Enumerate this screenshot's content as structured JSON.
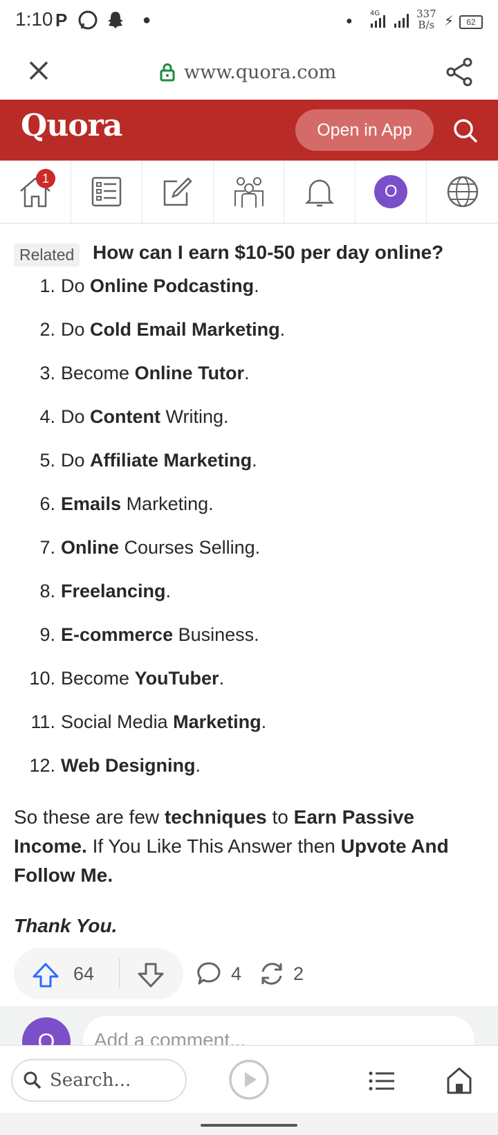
{
  "status_bar": {
    "time": "1:10",
    "net_type": "4G",
    "speed_value": "337",
    "speed_unit": "B/s",
    "battery": "62"
  },
  "browser": {
    "url": "www.quora.com"
  },
  "header": {
    "logo": "Quora",
    "open_in_app": "Open in App"
  },
  "nav": {
    "home_badge": "1",
    "avatar_letter": "O"
  },
  "answer": {
    "related_label": "Related",
    "question": "How can I earn $10-50 per day online?",
    "list": [
      {
        "num": "1.",
        "parts": [
          {
            "t": "Do ",
            "b": false
          },
          {
            "t": "Online Podcasting",
            "b": true
          },
          {
            "t": ".",
            "b": false
          }
        ]
      },
      {
        "num": "2.",
        "parts": [
          {
            "t": "Do ",
            "b": false
          },
          {
            "t": "Cold Email Marketing",
            "b": true
          },
          {
            "t": ".",
            "b": false
          }
        ]
      },
      {
        "num": "3.",
        "parts": [
          {
            "t": "Become ",
            "b": false
          },
          {
            "t": "Online Tutor",
            "b": true
          },
          {
            "t": ".",
            "b": false
          }
        ]
      },
      {
        "num": "4.",
        "parts": [
          {
            "t": "Do ",
            "b": false
          },
          {
            "t": "Content",
            "b": true
          },
          {
            "t": " Writing.",
            "b": false
          }
        ]
      },
      {
        "num": "5.",
        "parts": [
          {
            "t": "Do ",
            "b": false
          },
          {
            "t": "Affiliate Marketing",
            "b": true
          },
          {
            "t": ".",
            "b": false
          }
        ]
      },
      {
        "num": "6.",
        "parts": [
          {
            "t": "Emails",
            "b": true
          },
          {
            "t": " Marketing.",
            "b": false
          }
        ]
      },
      {
        "num": "7.",
        "parts": [
          {
            "t": "Online",
            "b": true
          },
          {
            "t": " Courses Selling.",
            "b": false
          }
        ]
      },
      {
        "num": "8.",
        "parts": [
          {
            "t": "Freelancing",
            "b": true
          },
          {
            "t": ".",
            "b": false
          }
        ]
      },
      {
        "num": "9.",
        "parts": [
          {
            "t": "E-commerce",
            "b": true
          },
          {
            "t": " Business.",
            "b": false
          }
        ]
      },
      {
        "num": "10.",
        "parts": [
          {
            "t": "Become ",
            "b": false
          },
          {
            "t": "YouTuber",
            "b": true
          },
          {
            "t": ".",
            "b": false
          }
        ]
      },
      {
        "num": "11.",
        "parts": [
          {
            "t": "Social Media ",
            "b": false
          },
          {
            "t": "Marketing",
            "b": true
          },
          {
            "t": ".",
            "b": false
          }
        ]
      },
      {
        "num": "12.",
        "parts": [
          {
            "t": "Web Designing",
            "b": true
          },
          {
            "t": ".",
            "b": false
          }
        ]
      }
    ],
    "closing": [
      {
        "t": "So these are few ",
        "b": false
      },
      {
        "t": "techniques",
        "b": true
      },
      {
        "t": " to ",
        "b": false
      },
      {
        "t": "Earn Passive Income.",
        "b": true
      },
      {
        "t": " If You Like This Answer then ",
        "b": false
      },
      {
        "t": "Upvote And Follow Me.",
        "b": true
      }
    ],
    "thanks": "Thank You."
  },
  "actions": {
    "upvotes": "64",
    "comments": "4",
    "shares": "2"
  },
  "comment": {
    "avatar_letter": "O",
    "placeholder": "Add a comment..."
  },
  "bottom": {
    "search_placeholder": "Search..."
  },
  "colors": {
    "quora_red": "#b92b27",
    "upvote_blue": "#2e69ff",
    "avatar_purple": "#7b4fc9"
  }
}
